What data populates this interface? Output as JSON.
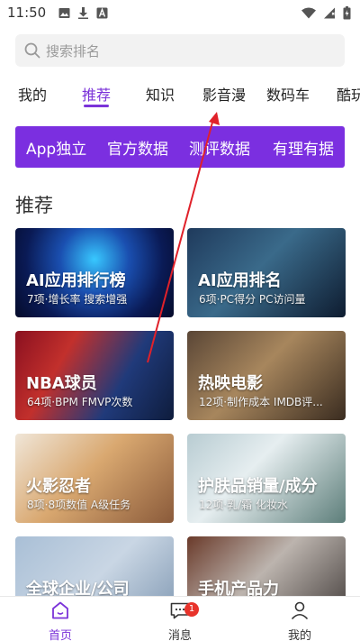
{
  "status_bar": {
    "time": "11:50",
    "left_icons": [
      "image-icon",
      "download-icon",
      "a-icon"
    ],
    "right_icons": [
      "wifi-icon",
      "signal-icon",
      "battery-icon"
    ]
  },
  "search": {
    "placeholder": "搜索排名"
  },
  "tabs": [
    {
      "label": "我的",
      "active": false
    },
    {
      "label": "推荐",
      "active": true
    },
    {
      "label": "知识",
      "active": false
    },
    {
      "label": "影音漫",
      "active": false
    },
    {
      "label": "数码车",
      "active": false
    },
    {
      "label": "酷玩",
      "active": false
    }
  ],
  "chips": [
    "App独立",
    "官方数据",
    "测评数据",
    "有理有据"
  ],
  "section": {
    "title": "推荐"
  },
  "cards": [
    {
      "title": "AI应用排行榜",
      "subtitle": "7项·增长率 搜索增强"
    },
    {
      "title": "AI应用排名",
      "subtitle": "6项·PC得分 PC访问量"
    },
    {
      "title": "NBA球员",
      "subtitle": "64项·BPM FMVP次数"
    },
    {
      "title": "热映电影",
      "subtitle": "12项·制作成本 IMDB评..."
    },
    {
      "title": "火影忍者",
      "subtitle": "8项·8项数值 A级任务"
    },
    {
      "title": "护肤品销量/成分",
      "subtitle": "12项·乳/霜 化妆水"
    },
    {
      "title": "全球企业/公司",
      "subtitle": ""
    },
    {
      "title": "手机产品力",
      "subtitle": ""
    }
  ],
  "bottom_nav": [
    {
      "label": "首页",
      "icon": "home-icon",
      "active": true
    },
    {
      "label": "消息",
      "icon": "message-icon",
      "active": false,
      "badge": "1"
    },
    {
      "label": "我的",
      "icon": "profile-icon",
      "active": false
    }
  ],
  "colors": {
    "accent": "#7b33d9",
    "chip_bar": "#7b2fe0",
    "badge": "#e8332b",
    "annotation_arrow": "#e0212a"
  }
}
